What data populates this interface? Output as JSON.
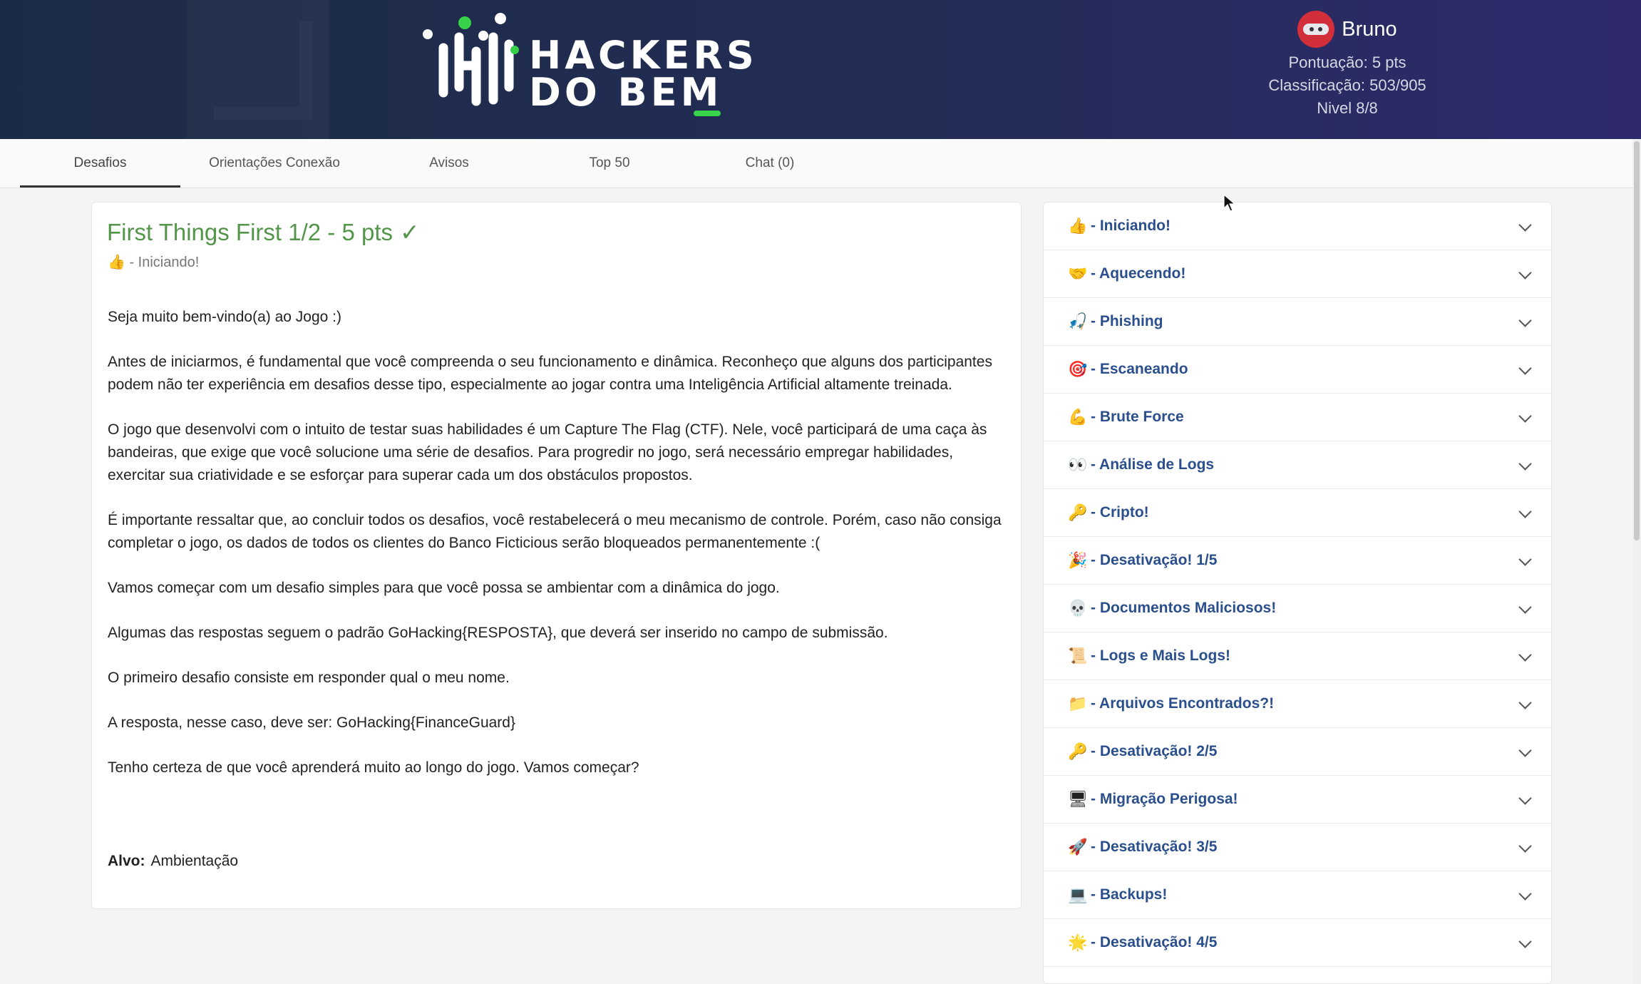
{
  "header": {
    "logo_line1": "HACKERS",
    "logo_line2": "DO BEM",
    "user": {
      "name": "Bruno",
      "score": "Pontuação: 5 pts",
      "rank": "Classificação: 503/905",
      "level": "Nivel 8/8"
    }
  },
  "tabs": [
    {
      "label": "Desafios",
      "active": true
    },
    {
      "label": "Orientações Conexão"
    },
    {
      "label": "Avisos"
    },
    {
      "label": "Top 50"
    },
    {
      "label": "Chat (0)"
    }
  ],
  "challenge": {
    "title": "First Things First 1/2 - 5 pts",
    "check": "✓",
    "category_emoji": "👍",
    "category": " - Iniciando!",
    "paragraphs": [
      "Seja muito bem-vindo(a) ao Jogo :)",
      "Antes de iniciarmos, é fundamental que você compreenda o seu funcionamento e dinâmica. Reconheço que alguns dos participantes podem não ter experiência em desafios desse tipo, especialmente ao jogar contra uma Inteligência Artificial altamente treinada.",
      "O jogo que desenvolvi com o intuito de testar suas habilidades é um Capture The Flag (CTF). Nele, você participará de uma caça às bandeiras, que exige que você solucione uma série de desafios. Para progredir no jogo, será necessário empregar habilidades, exercitar sua criatividade e se esforçar para superar cada um dos obstáculos propostos.",
      "É importante ressaltar que, ao concluir todos os desafios, você restabelecerá o meu mecanismo de controle. Porém, caso não consiga completar o jogo, os dados de todos os clientes do Banco Ficticious serão bloqueados permanentemente :(",
      "Vamos começar com um desafio simples para que você possa se ambientar com a dinâmica do jogo.",
      "Algumas das respostas seguem o padrão GoHacking{RESPOSTA}, que deverá ser inserido no campo de submissão.",
      "O primeiro desafio consiste em responder qual o meu nome.",
      "A resposta, nesse caso, deve ser: GoHacking{FinanceGuard}",
      "Tenho certeza de que você aprenderá muito ao longo do jogo. Vamos começar?"
    ],
    "target_label": "Alvo:",
    "target_value": "Ambientação"
  },
  "categories": [
    {
      "emoji": "👍",
      "label": "- Iniciando!"
    },
    {
      "emoji": "🤝",
      "label": "- Aquecendo!"
    },
    {
      "emoji": "🎣",
      "label": "- Phishing"
    },
    {
      "emoji": "🎯",
      "label": "- Escaneando"
    },
    {
      "emoji": "💪",
      "label": "- Brute Force"
    },
    {
      "emoji": "👀",
      "label": "- Análise de Logs"
    },
    {
      "emoji": "🔑",
      "label": "- Cripto!"
    },
    {
      "emoji": "🎉",
      "label": "- Desativação! 1/5"
    },
    {
      "emoji": "💀",
      "label": "- Documentos Maliciosos!"
    },
    {
      "emoji": "📜",
      "label": "- Logs e Mais Logs!"
    },
    {
      "emoji": "📁",
      "label": "- Arquivos Encontrados?!"
    },
    {
      "emoji": "🔑",
      "label": "- Desativação! 2/5"
    },
    {
      "emoji": "🖥",
      "label": "- Migração Perigosa!"
    },
    {
      "emoji": "🚀",
      "label": "- Desativação! 3/5"
    },
    {
      "emoji": "💻",
      "label": "- Backups!"
    },
    {
      "emoji": "🌟",
      "label": "- Desativação! 4/5"
    }
  ],
  "colors": {
    "title_green": "#53964a",
    "category_blue": "#2a4f8c",
    "header_start": "#1c2b45",
    "header_end": "#2e2a6c",
    "accent_green": "#37d24a"
  }
}
